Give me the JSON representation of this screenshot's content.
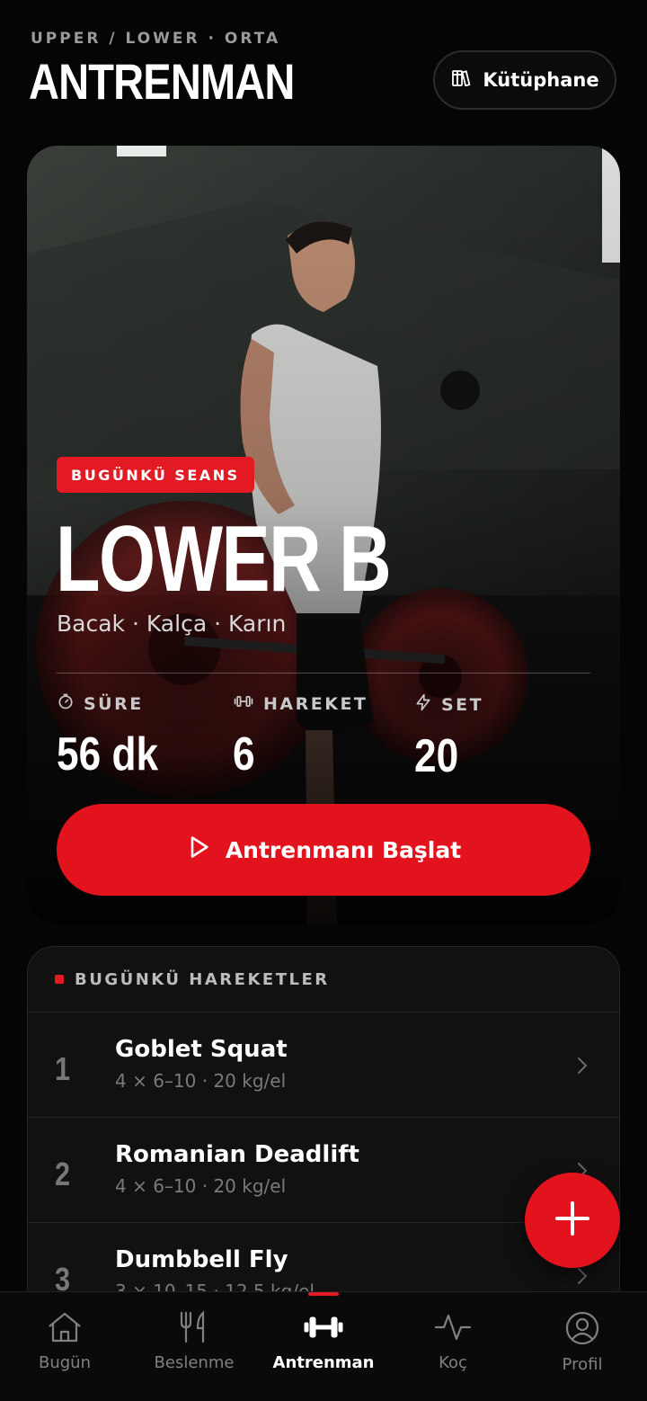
{
  "header": {
    "eyebrow": "UPPER / LOWER · ORTA",
    "title": "ANTRENMAN",
    "library_label": "Kütüphane"
  },
  "hero": {
    "badge": "BUGÜNKÜ SEANS",
    "session_title": "LOWER B",
    "session_subtitle": "Bacak · Kalça · Karın",
    "stats": [
      {
        "label": "SÜRE",
        "value": "56 dk",
        "icon": "timer-icon"
      },
      {
        "label": "HAREKET",
        "value": "6",
        "icon": "dumbbell-icon"
      },
      {
        "label": "SET",
        "value": "20",
        "icon": "lightning-icon"
      }
    ],
    "start_label": "Antrenmanı Başlat"
  },
  "exercises": {
    "heading": "BUGÜNKÜ HAREKETLER",
    "items": [
      {
        "num": "1",
        "name": "Goblet Squat",
        "meta": "4 × 6–10 · 20 kg/el"
      },
      {
        "num": "2",
        "name": "Romanian Deadlift",
        "meta": "4 × 6–10 · 20 kg/el"
      },
      {
        "num": "3",
        "name": "Dumbbell Fly",
        "meta": "3 × 10–15 · 12.5 kg/el"
      }
    ]
  },
  "tabbar": {
    "items": [
      {
        "label": "Bugün",
        "icon": "home-icon"
      },
      {
        "label": "Beslenme",
        "icon": "fork-knife-icon"
      },
      {
        "label": "Antrenman",
        "icon": "dumbbell-icon"
      },
      {
        "label": "Koç",
        "icon": "activity-icon"
      },
      {
        "label": "Profil",
        "icon": "user-icon"
      }
    ],
    "active_index": 2
  },
  "colors": {
    "accent": "#e31a23",
    "background": "#050505",
    "card": "#111111"
  }
}
